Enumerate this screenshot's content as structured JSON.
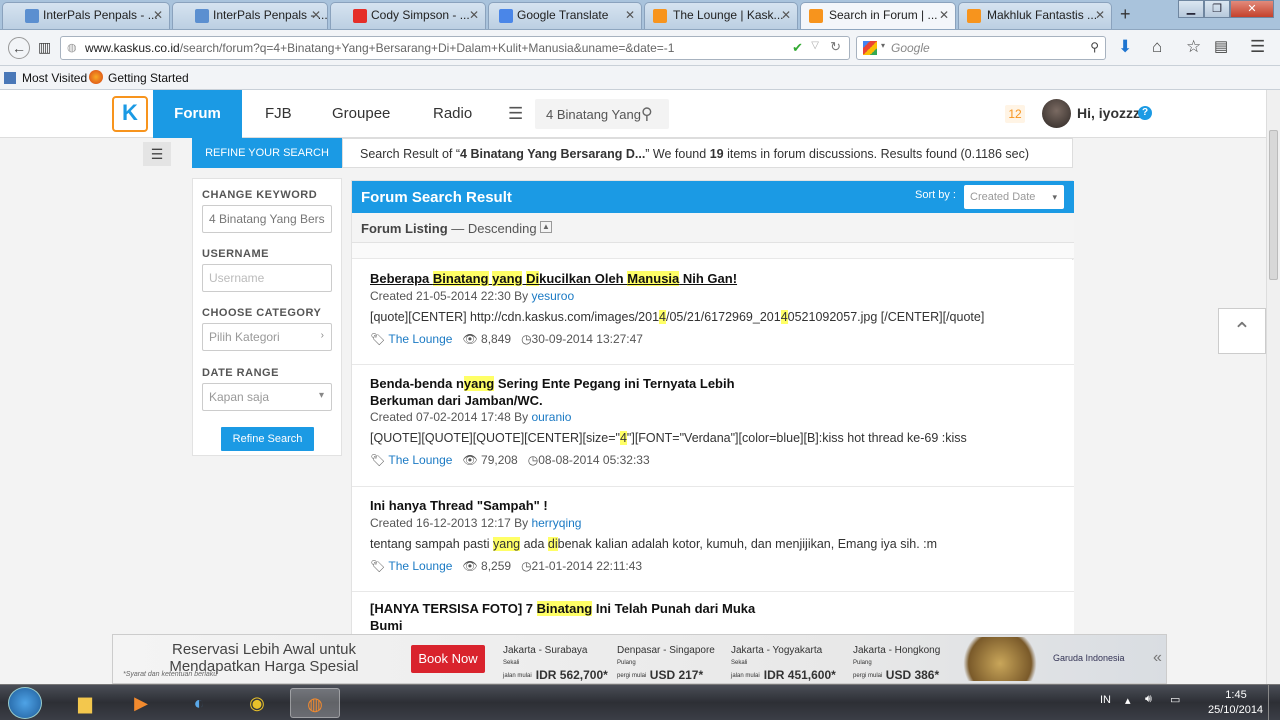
{
  "browser": {
    "tabs": [
      {
        "title": "InterPals Penpals - ...",
        "icon_color": "#5b8fd0"
      },
      {
        "title": "InterPals Penpals - ...",
        "icon_color": "#5b8fd0"
      },
      {
        "title": "Cody Simpson - ...",
        "icon_color": "#e52d27"
      },
      {
        "title": "Google Translate",
        "icon_color": "#4a86e8"
      },
      {
        "title": "The Lounge | Kask...",
        "icon_color": "#f7941d"
      },
      {
        "title": "Search in Forum | ...",
        "icon_color": "#f7941d"
      },
      {
        "title": "Makhluk Fantastis ...",
        "icon_color": "#f7941d"
      }
    ],
    "url_host": "www.kaskus.co.id",
    "url_path": "/search/forum?q=4+Binatang+Yang+Bersarang+Di+Dalam+Kulit+Manusia&uname=&date=-1",
    "search_placeholder": "Google",
    "bookmarks": [
      "Most Visited",
      "Getting Started"
    ]
  },
  "site": {
    "nav": {
      "forum": "Forum",
      "fjb": "FJB",
      "groupee": "Groupee",
      "radio": "Radio",
      "search_value": "4 Binatang Yang"
    },
    "notifications": "12",
    "greeting": "Hi, iyozzz",
    "refine_tab": "REFINE YOUR SEARCH",
    "result_info": {
      "prefix": "Search Result of “",
      "query": "4 Binatang Yang Bersarang D...",
      "middle": "” We found ",
      "count": "19",
      "suffix": " items in forum discussions. Results found (0.1186 sec)"
    },
    "sidebar": {
      "keyword_label": "CHANGE KEYWORD",
      "keyword_value": "4 Binatang Yang Bers",
      "username_label": "USERNAME",
      "username_placeholder": "Username",
      "category_label": "CHOOSE CATEGORY",
      "category_value": "Pilih Kategori",
      "date_label": "DATE RANGE",
      "date_value": "Kapan saja",
      "refine_button": "Refine Search"
    },
    "results_header": {
      "title": "Forum Search Result",
      "sort_label": "Sort by :",
      "sort_value": "Created Date",
      "listing": "Forum Listing",
      "order": " — Descending"
    },
    "results": [
      {
        "created": "Created 21-05-2014 22:30 By ",
        "author": "yesuroo",
        "snippet_a": "[quote][CENTER] http://cdn.kaskus.com/images/201",
        "snippet_hl1": "4",
        "snippet_b": "/05/21/6172969_201",
        "snippet_hl2": "4",
        "snippet_c": "0521092057.jpg [/CENTER][/quote]",
        "category": "The Lounge",
        "views": "8,849",
        "last": "30-09-2014 13:27:47"
      },
      {
        "title_a": "Benda-benda n",
        "title_hl": "yang",
        "title_b": " Sering Ente Pegang ini Ternyata Lebih",
        "title_line2": "Berkuman dari Jamban/WC.",
        "created": "Created 07-02-2014 17:48 By ",
        "author": "ouranio",
        "snippet_a": "[QUOTE][QUOTE][QUOTE][CENTER][size=\"",
        "snippet_hl1": "4",
        "snippet_b": "\"][FONT=\"Verdana\"][color=blue][B]:kiss hot thread ke-69 :kiss",
        "category": "The Lounge",
        "views": "79,208",
        "last": "08-08-2014 05:32:33"
      },
      {
        "title": "Ini hanya Thread \"Sampah\" !",
        "created": "Created 16-12-2013 12:17 By ",
        "author": "herryqing",
        "snippet_a": "tentang sampah pasti ",
        "snippet_hl1": "yang",
        "snippet_b": " ada ",
        "snippet_hl2": "di",
        "snippet_c": "benak kalian adalah kotor, kumuh, dan menjijikan, Emang iya sih. :m",
        "category": "The Lounge",
        "views": "8,259",
        "last": "21-01-2014 22:11:43"
      },
      {
        "title_a": "[HANYA TERSISA FOTO] 7 ",
        "title_hl": "Binatang",
        "title_b": " Ini Telah Punah dari Muka",
        "title_line2": "Bumi"
      }
    ],
    "result1_title_parts": [
      "Beberapa ",
      "Binatang",
      " ",
      "yang",
      " ",
      "Di",
      "kucilkan Oleh ",
      "Manusia",
      " Nih Gan!"
    ]
  },
  "ad": {
    "headline": "Reservasi Lebih Awal untuk Mendapatkan Harga Spesial",
    "note": "*Syarat dan ketentuan berlaku",
    "cta": "Book Now",
    "routes": [
      {
        "route": "Jakarta - Surabaya",
        "from": "Sekali jalan mulai dari",
        "price": "IDR 562,700*"
      },
      {
        "route": "Denpasar - Singapore",
        "from": "Pulang pergi mulai dari",
        "price": "USD 217*"
      },
      {
        "route": "Jakarta - Yogyakarta",
        "from": "Sekali jalan mulai dari",
        "price": "IDR 451,600*"
      },
      {
        "route": "Jakarta - Hongkong",
        "from": "Pulang pergi mulai dari",
        "price": "USD 386*"
      }
    ],
    "brand": "Garuda Indonesia"
  },
  "taskbar": {
    "lang": "IN",
    "time": "1:45",
    "date": "25/10/2014"
  }
}
